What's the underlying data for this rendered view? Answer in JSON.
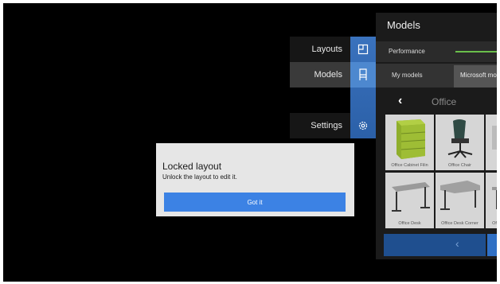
{
  "nav": {
    "items": [
      {
        "label": "Layouts",
        "icon": "layouts-icon"
      },
      {
        "label": "Models",
        "icon": "chair-icon"
      },
      {
        "label": "Settings",
        "icon": "gear-icon"
      }
    ],
    "active": "Models"
  },
  "panel": {
    "title": "Models",
    "performance_label": "Performance",
    "tabs": {
      "my_models": "My models",
      "microsoft": "Microsoft mo"
    },
    "category": "Office",
    "tiles": [
      {
        "caption": "Office Cabinet Filin"
      },
      {
        "caption": "Office Chair"
      },
      {
        "caption": ""
      },
      {
        "caption": "Office Desk"
      },
      {
        "caption": "Office Desk Corner"
      },
      {
        "caption": "Of"
      }
    ]
  },
  "dialog": {
    "title": "Locked layout",
    "body": "Unlock the layout to edit it.",
    "button": "Got it"
  },
  "colors": {
    "accent": "#3c82e4",
    "nav_blue": "#2b60a8",
    "performance_bar": "#6abf4b"
  }
}
